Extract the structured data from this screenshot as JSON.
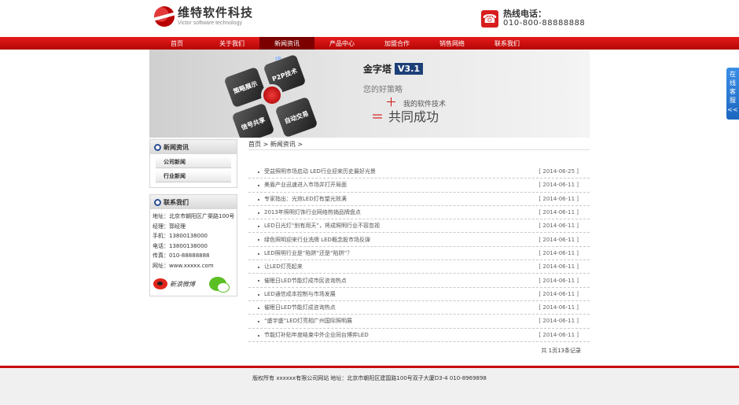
{
  "header": {
    "logo_cn": "维特软件科技",
    "logo_en": "Victor software technology",
    "hotline_label": "热线电话：",
    "hotline_number": "010-800-88888888"
  },
  "nav": {
    "items": [
      {
        "label": "首页"
      },
      {
        "label": "关于我们"
      },
      {
        "label": "新闻资讯"
      },
      {
        "label": "产品中心"
      },
      {
        "label": "加盟合作"
      },
      {
        "label": "销售网络"
      },
      {
        "label": "联系我们"
      }
    ],
    "active_index": 2
  },
  "banner": {
    "cubes": [
      "策略展示",
      "P2P技术",
      "信号共享",
      "自动交易"
    ],
    "cube_tag": "IP",
    "title": "金字塔",
    "version": "V3.1",
    "line1": "您的好策略",
    "line2_symbol": "＋",
    "line2": "我的软件技术",
    "line3_symbol": "＝",
    "line3": "共同成功"
  },
  "sidebar": {
    "news_title": "新闻资讯",
    "news_cats": [
      "公司新闻",
      "行业新闻"
    ],
    "contact_title": "联系我们",
    "contact_lines": [
      "地址：北京市朝阳区广渠路100号",
      "经理：郭经理",
      "手机：13800138000",
      "电话：13800138000",
      "传真：010-88888888",
      "网址：www.xxxxx.com"
    ],
    "weibo_label": "新浪微博"
  },
  "main": {
    "breadcrumb": "首页 > 新闻资讯 >",
    "news": [
      {
        "title": "受益照明市场启动 LED行业迎来历史最好光景",
        "date": "[ 2014-06-25 ]"
      },
      {
        "title": "美盾产业迅速进入市场并打开局面",
        "date": "[ 2014-06-11 ]"
      },
      {
        "title": "专家指出：光效LED灯有望光效满",
        "date": "[ 2014-06-11 ]"
      },
      {
        "title": "2013年照明灯饰行业网络热销品牌盘点",
        "date": "[ 2014-06-11 ]"
      },
      {
        "title": "LED日光灯“别有用天”，将成照明行业不容忽视",
        "date": "[ 2014-06-11 ]"
      },
      {
        "title": "绿色照明迎来行业洗牌 LED概念股市场反弹",
        "date": "[ 2014-06-11 ]"
      },
      {
        "title": "LED照明行业是“陷阱”还是“陷阱”？",
        "date": "[ 2014-06-11 ]"
      },
      {
        "title": "让LED灯亮起来",
        "date": "[ 2014-06-11 ]"
      },
      {
        "title": "催眠日LED节能灯成市民咨询热点",
        "date": "[ 2014-06-11 ]"
      },
      {
        "title": "LED通信成本控制与市场发展",
        "date": "[ 2014-06-11 ]"
      },
      {
        "title": "催眠日LED节能灯成咨询热点",
        "date": "[ 2014-06-11 ]"
      },
      {
        "title": "“盛宇盛”LED灯亮相广州国际照明展",
        "date": "[ 2014-06-11 ]"
      },
      {
        "title": "节能灯补贴年度结束中外企业同台博弈LED",
        "date": "[ 2014-06-11 ]"
      }
    ],
    "pager": "共 1页13条记录"
  },
  "footer": {
    "text": "版权所有 xxxxxx有限公司网站 地址：北京市朝阳区建国路100号双子大厦D3-4 010-8969898"
  },
  "float_service": {
    "chars": [
      "在",
      "线",
      "客",
      "服"
    ],
    "arrow": "<<"
  }
}
